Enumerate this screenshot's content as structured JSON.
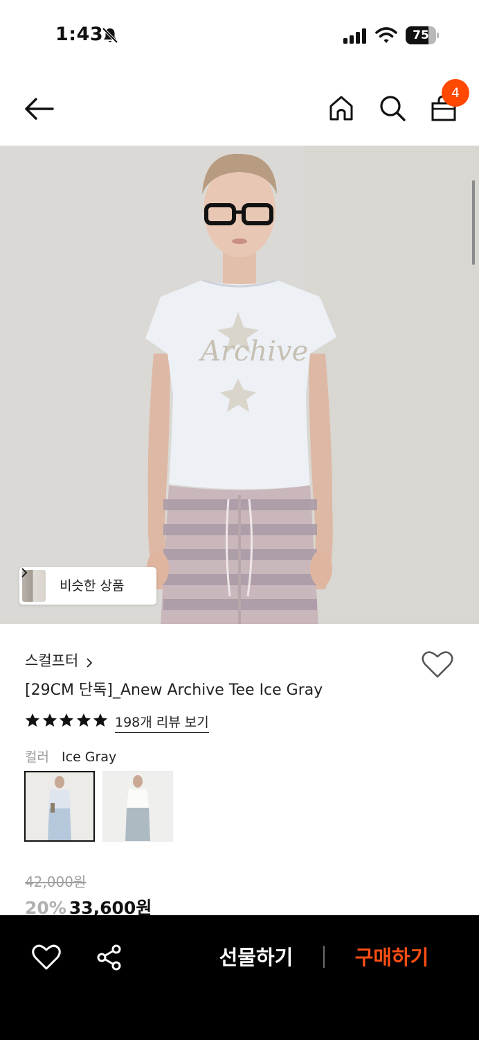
{
  "status_bar": {
    "time": "1:43",
    "battery": "75",
    "battery_level": 0.75
  },
  "header": {
    "cart_count": "4"
  },
  "hero": {
    "similar_products_label": "비슷한 상품"
  },
  "product": {
    "brand": "스컬프터",
    "title": "[29CM 단독]_Anew Archive Tee Ice Gray",
    "rating_stars": 5,
    "review_link": "198개 리뷰 보기",
    "color_label": "컬러",
    "color_value": "Ice Gray",
    "original_price": "42,000원",
    "discount": "20%",
    "sale_price": "33,600원"
  },
  "bottom_bar": {
    "gift_label": "선물하기",
    "buy_label": "구매하기"
  },
  "colors": {
    "accent": "#ff4800",
    "buy_text": "#ff4f13",
    "bottom_bar_bg": "#000000"
  },
  "icons": [
    "bell-slash-icon",
    "signal-icon",
    "wifi-icon",
    "battery-icon",
    "back-arrow-icon",
    "home-icon",
    "search-icon",
    "shopping-bag-icon",
    "chevron-right-icon",
    "heart-icon",
    "star-icon",
    "share-icon"
  ]
}
